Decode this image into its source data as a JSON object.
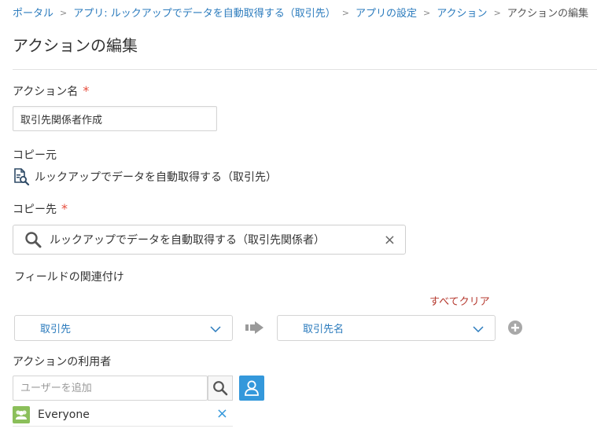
{
  "breadcrumb": {
    "items": [
      "ポータル",
      "アプリ: ルックアップでデータを自動取得する（取引先）",
      "アプリの設定",
      "アクション"
    ],
    "current": "アクションの編集",
    "separator": ">"
  },
  "page_title": "アクションの編集",
  "action_name": {
    "label": "アクション名",
    "required_mark": "*",
    "value": "取引先関係者作成"
  },
  "copy_source": {
    "label": "コピー元",
    "app_name": "ルックアップでデータを自動取得する（取引先）",
    "icon": "app-search-icon"
  },
  "copy_dest": {
    "label": "コピー先",
    "required_mark": "*",
    "app_name": "ルックアップでデータを自動取得する（取引先関係者）",
    "clear": "×"
  },
  "field_mapping": {
    "label": "フィールドの関連付け",
    "clear_all": "すべてクリア",
    "rows": [
      {
        "from": "取引先",
        "to": "取引先名"
      }
    ]
  },
  "users": {
    "label": "アクションの利用者",
    "placeholder": "ユーザーを追加",
    "entries": [
      {
        "name": "Everyone",
        "remove": "×"
      }
    ]
  },
  "colors": {
    "link": "#2b7bbd",
    "accent": "#3498db",
    "required": "#e74c3c",
    "clear_all": "#b5382e",
    "everyone_avatar": "#8bbf5a"
  }
}
